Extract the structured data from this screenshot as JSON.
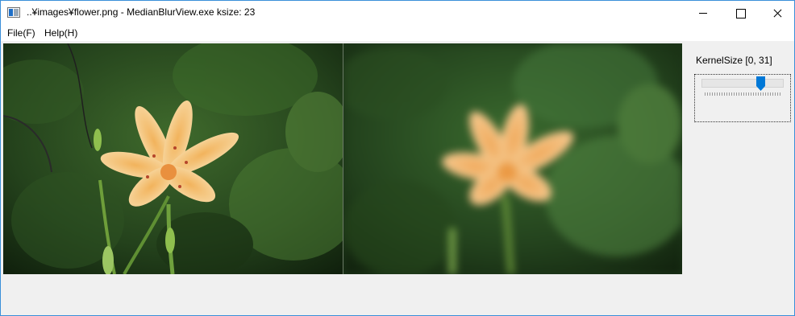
{
  "window": {
    "title": "..¥images¥flower.png - MedianBlurView.exe  ksize: 23",
    "app_icon": "window-app-icon",
    "controls": [
      "minimize-icon",
      "maximize-icon",
      "close-icon"
    ]
  },
  "menu": {
    "items": [
      {
        "label": "File(F)"
      },
      {
        "label": "Help(H)"
      }
    ]
  },
  "panel": {
    "kernel_label": "KernelSize [0, 31]",
    "slider": {
      "min": 0,
      "max": 31,
      "value": 23
    }
  },
  "images": {
    "original": "flower-original-image",
    "blurred": "flower-median-blurred-image"
  },
  "colors": {
    "accent": "#0078d7",
    "window_border": "#3a8fd9",
    "background": "#f0f0f0"
  }
}
